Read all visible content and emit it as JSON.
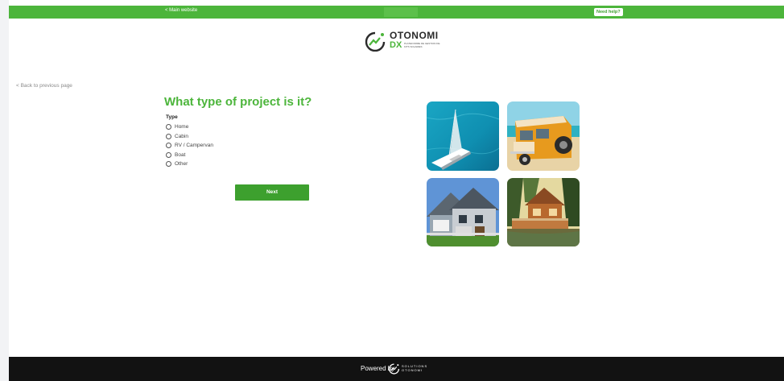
{
  "topbar": {
    "main_link": "< Main website",
    "help_button": "Need help?"
  },
  "logo": {
    "brand": "OTONOMI",
    "dx": "DX",
    "subtitle": "PLATEFORME DE GESTION DE KITS SOLAIRES"
  },
  "nav": {
    "back_link": "< Back to previous page"
  },
  "form": {
    "question": "What type of project is it?",
    "group_label": "Type",
    "options": [
      "Home",
      "Cabin",
      "RV / Campervan",
      "Boat",
      "Other"
    ],
    "next_button": "Next"
  },
  "footer": {
    "powered_by": "Powered by",
    "brand_line1": "SOLUTIONS",
    "brand_line2": "OTONOMI"
  },
  "colors": {
    "accent": "#4cb53b",
    "accent_dark": "#3da02e",
    "footer_bg": "#121212"
  }
}
